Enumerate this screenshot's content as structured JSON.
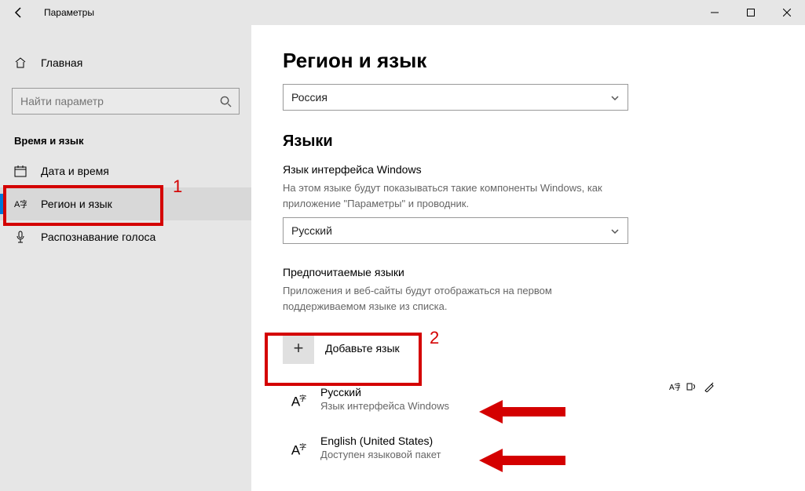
{
  "app_title": "Параметры",
  "sidebar": {
    "home_label": "Главная",
    "search_placeholder": "Найти параметр",
    "category_title": "Время и язык",
    "items": [
      {
        "label": "Дата и время"
      },
      {
        "label": "Регион и язык"
      },
      {
        "label": "Распознавание голоса"
      }
    ]
  },
  "main": {
    "page_title": "Регион и язык",
    "country_selected": "Россия",
    "section_languages": "Языки",
    "display_lang_title": "Язык интерфейса Windows",
    "display_lang_desc": "На этом языке будут показываться такие компоненты Windows, как приложение \"Параметры\" и проводник.",
    "display_lang_selected": "Русский",
    "preferred_title": "Предпочитаемые языки",
    "preferred_desc": "Приложения и веб-сайты будут отображаться на первом поддерживаемом языке из списка.",
    "add_lang_label": "Добавьте язык",
    "languages": [
      {
        "name": "Русский",
        "sub": "Язык интерфейса Windows"
      },
      {
        "name": "English (United States)",
        "sub": "Доступен языковой пакет"
      }
    ]
  },
  "annotations": {
    "label1": "1",
    "label2": "2"
  }
}
